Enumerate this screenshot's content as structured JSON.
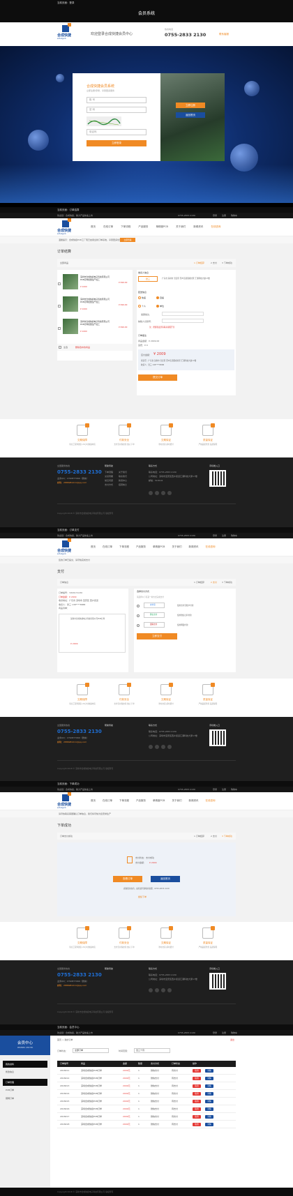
{
  "colors": {
    "accent": "#f08a24",
    "brand": "#1a4e9e",
    "danger": "#e53935",
    "dark": "#0d0d0d"
  },
  "login": {
    "section_label": "当前页面：登录",
    "title": "会员系统",
    "welcome": "欢迎登录合成快捷会员中心",
    "hotline_label": "热线电话",
    "hotline": "0755-2833 2130",
    "side_link": "联系客服",
    "brand_cn": "合成快捷",
    "brand_en": "szhckjpcb",
    "box_title": "合成快捷会员系统",
    "box_sub": "立即注册/登录，享受更多服务",
    "user_ph": "账 号",
    "pwd_ph": "密 码",
    "code_ph": "验证码",
    "login_btn": "立即登录",
    "reg_btn": "立即注册",
    "forgot_btn": "返回首页"
  },
  "topnav": {
    "welcome": "欢迎您！合成快捷，助力产品快速上市",
    "phone": "0755-2833 2130",
    "links": [
      "登录",
      "注册",
      "购物车"
    ],
    "items": [
      "首页",
      "在线订单",
      "下单流程",
      "产品服务",
      "单精度PCB",
      "关于我们",
      "新闻资讯",
      "在线咨询"
    ],
    "notice": "温馨提示：合成快捷PCB工厂现已启用全新订单系统，享受更多优惠服务",
    "notice_btn": "立即查看"
  },
  "order": {
    "section_label": "当前页面：订单结算",
    "page_title": "订单结算",
    "steps": [
      "1 订单结算",
      "2 支付",
      "3 下单成功"
    ],
    "cart_title": "全部商品",
    "products": [
      {
        "name": "深圳市合成快捷电子科技有限公司PCB打样批量生产加工",
        "spec": "¥ 1000",
        "price": "¥ 699.00"
      },
      {
        "name": "深圳市合成快捷电子科技有限公司PCB打样批量生产加工",
        "spec": "¥ 1000",
        "price": "¥ 699.00"
      },
      {
        "name": "深圳市合成快捷电子科技有限公司PCB打样批量生产加工",
        "spec": "¥ 1000",
        "price": "¥ 699.00"
      }
    ],
    "select_all": "全选",
    "delete_sel": "删除选中的商品",
    "addr_title": "收货人信息",
    "addr_name": "张三",
    "addr_text": "广东省 深圳市 宝安区 西乡街道固戍社区 汇潮科技大厦17楼",
    "delivery_title": "配送信息",
    "delivery_opts": [
      "快递",
      "自提"
    ],
    "invoice_opts": [
      "个人",
      "单位"
    ],
    "invoice_title_label": "发票抬头：",
    "invoice_tax_label": "纳税人识别号：",
    "invoice_tip": "注：增值税发票请联系客服开具",
    "remark_title": "订单备注",
    "summary_rows": [
      "商品金额：¥ 2009.00",
      "运费：¥ 0"
    ],
    "total_label": "应付金额：",
    "total": "¥ 2009",
    "pay_addr": "寄送至：广东省 深圳市 宝安区 西乡街道固戍社区 汇潮科技大厦17楼",
    "pay_person": "收货人：张三 138****8888",
    "submit": "提交订单"
  },
  "features": [
    {
      "name": "交期保障",
      "desc": "专业工程师团队 24小时快速响应"
    },
    {
      "name": "付款安全",
      "desc": "支付宝担保交易 放心下单"
    },
    {
      "name": "交期保证",
      "desc": "准时交货 超时赔付"
    },
    {
      "name": "质量保证",
      "desc": "严格品质管控 品质保障"
    }
  ],
  "footer": {
    "hotline_label": "全国服务热线",
    "hotline": "0755-2833 2130",
    "qq": "业务QQ：1790877069（微信）",
    "email": "邮箱：2886981211@qq.com",
    "help_title": "帮助导航",
    "help_links": [
      "下单流程",
      "交货周期",
      "常见问题",
      "支付方式",
      "售后服务"
    ],
    "help_links2": [
      "关于我们",
      "联系我们",
      "新闻中心",
      "招贤纳士"
    ],
    "contact_title": "联系方式",
    "contact_lines": [
      "联系电话：0755-2833 2130",
      "公司地址：深圳市宝安区西乡街道汇潮科技大厦17楼",
      "邮编：518102"
    ],
    "app_title": "手机端入口",
    "copyright": "Copyright 2018 © 深圳市合成快捷电子科技有限公司 版权所有"
  },
  "pay": {
    "section_label": "当前页面：订单支付",
    "page_title": "支付",
    "notice": "您的订单已提交，请尽快完成支付",
    "info_title": "订单信息",
    "info_rows": [
      "订单编号：YZ20171230",
      "订单金额：¥ 2009",
      "收货地址：广东省 深圳市 宝安区 西乡街道",
      "收货人：张三 138****8888",
      "商品清单："
    ],
    "goods": "深圳市合成快捷电子科技有限公司PCB打样",
    "goods_total": "¥ 2009",
    "method_title": "选择支付方式",
    "method_tip": "请选择以下任意一种方式完成支付",
    "methods": [
      {
        "name": "支付宝",
        "desc": "使用支付宝账户付款"
      },
      {
        "name": "微信支付",
        "desc": "使用微信扫码付款"
      },
      {
        "name": "银联支付",
        "desc": "使用网银付款"
      }
    ],
    "pay_btn": "立即支付"
  },
  "success": {
    "section_label": "当前页面：下单成功",
    "page_title": "下单成功",
    "panel_title": "订单支付成功",
    "notice": "请尽快联系客服确认订单信息，我们将尽快为您安排生产",
    "box_line1": "支付状态：支付成功",
    "box_line2": "支付金额：",
    "box_amount": "¥ 2009",
    "btn_view": "查看订单",
    "btn_home": "返回首页",
    "tip": "感谢您的支持，如有疑问请联系客服：0755-2833 2130",
    "link": "继续下单"
  },
  "member": {
    "section_label": "当前页面：会员中心",
    "center_title": "会员中心",
    "center_sub": "MEMBER CENTER",
    "menu": [
      {
        "label": "我的资料",
        "active": true
      },
      {
        "label": "修改信息",
        "active": false
      },
      {
        "label": "订单管理",
        "active": true
      },
      {
        "label": "PCB订单",
        "active": false
      },
      {
        "label": "钢网订单",
        "active": false
      }
    ],
    "crumb": "首页 > 我的订单",
    "logout": "退出",
    "filter_label1": "订单状态：",
    "filter_val1": "全部订单",
    "filter_label2": "时间范围：",
    "filter_val2": "近三个月",
    "columns": [
      "订单编号",
      "商品",
      "金额",
      "数量",
      "支付方式",
      "订单状态",
      "操作"
    ],
    "rows": [
      {
        "id": "2018211",
        "item": "深圳合成快捷PCB打样",
        "amt": "2009元",
        "qty": "1",
        "pay": "微信支付",
        "status": "待支付"
      },
      {
        "id": "2018212",
        "item": "深圳合成快捷PCB打样",
        "amt": "2009元",
        "qty": "1",
        "pay": "微信支付",
        "status": "待支付"
      },
      {
        "id": "2018213",
        "item": "深圳合成快捷PCB打样",
        "amt": "2009元",
        "qty": "1",
        "pay": "微信支付",
        "status": "待支付"
      },
      {
        "id": "2018214",
        "item": "深圳合成快捷PCB打样",
        "amt": "2009元",
        "qty": "1",
        "pay": "微信支付",
        "status": "待支付"
      },
      {
        "id": "2018215",
        "item": "深圳合成快捷PCB打样",
        "amt": "2009元",
        "qty": "1",
        "pay": "微信支付",
        "status": "待支付"
      },
      {
        "id": "2018216",
        "item": "深圳合成快捷PCB打样",
        "amt": "2009元",
        "qty": "1",
        "pay": "微信支付",
        "status": "待支付"
      },
      {
        "id": "2018217",
        "item": "深圳合成快捷PCB打样",
        "amt": "2009元",
        "qty": "1",
        "pay": "微信支付",
        "status": "待支付"
      },
      {
        "id": "2018218",
        "item": "深圳合成快捷PCB打样",
        "amt": "2009元",
        "qty": "1",
        "pay": "微信支付",
        "status": "待支付"
      }
    ],
    "row_btn1": "取消",
    "row_btn2": "详情",
    "copyright": "Copyright 2018 © 深圳市合成快捷电子科技有限公司 版权所有"
  }
}
